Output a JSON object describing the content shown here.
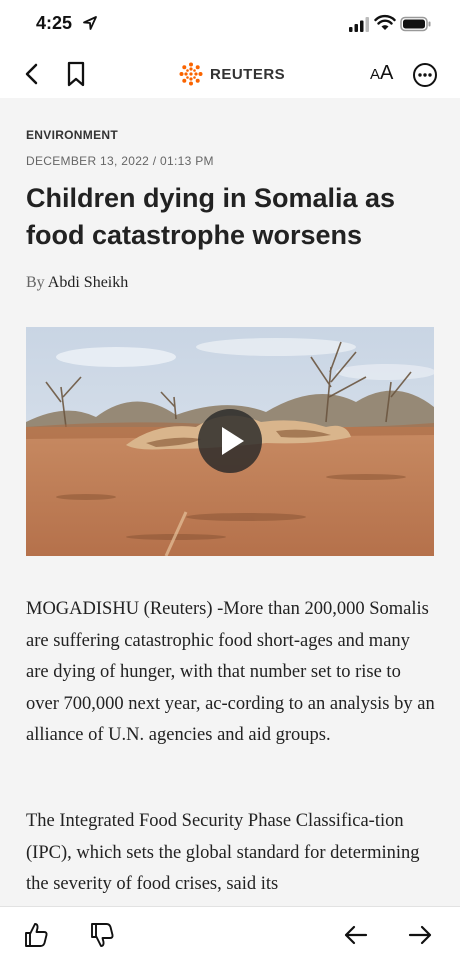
{
  "status_bar": {
    "time": "4:25"
  },
  "nav": {
    "brand": "REUTERS",
    "font_size_label": "A",
    "font_size_label_small": "A"
  },
  "article": {
    "category": "ENVIRONMENT",
    "dateline": "DECEMBER 13, 2022 / 01:13 PM",
    "headline": "Children dying in Somalia as food catastrophe worsens",
    "byline_prefix": "By",
    "author": "Abdi Sheikh",
    "paragraphs": [
      "MOGADISHU (Reuters) -More than 200,000 Somalis are suffering catastrophic food short-ages and many are dying of hunger, with that number set to rise to over 700,000 next year, ac-cording to an analysis by an alliance of U.N. agencies and aid groups.",
      "The Integrated Food Security Phase Classifica-tion (IPC), which sets the global standard for determining the severity of food crises, said its"
    ]
  },
  "colors": {
    "accent": "#fa6400",
    "text": "#222222",
    "background": "#f4f4f4"
  },
  "icons": [
    "location-arrow-icon",
    "signal-icon",
    "wifi-icon",
    "battery-icon",
    "back-chevron-icon",
    "bookmark-icon",
    "reuters-logo-icon",
    "more-options-icon",
    "play-icon",
    "thumbs-up-icon",
    "thumbs-down-icon",
    "arrow-left-icon",
    "arrow-right-icon"
  ]
}
